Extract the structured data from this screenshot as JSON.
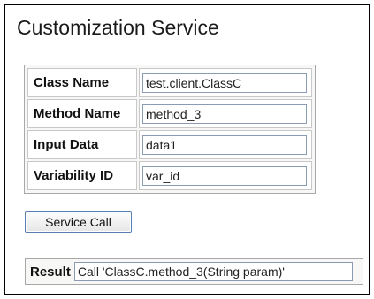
{
  "title": "Customization Service",
  "form": {
    "rows": [
      {
        "label": "Class Name",
        "value": "test.client.ClassC"
      },
      {
        "label": "Method Name",
        "value": "method_3"
      },
      {
        "label": "Input Data",
        "value": "data1"
      },
      {
        "label": "Variability ID",
        "value": "var_id"
      }
    ]
  },
  "service_button": {
    "label": "Service Call"
  },
  "result": {
    "label": "Result",
    "value": "Call 'ClassC.method_3(String param)'"
  }
}
